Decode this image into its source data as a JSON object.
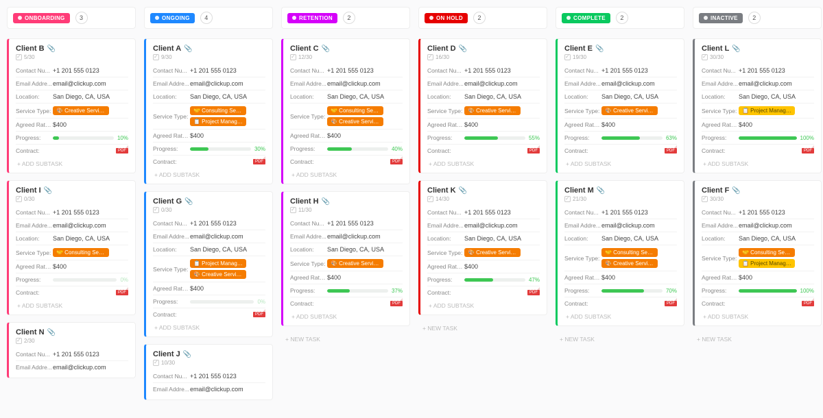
{
  "colors": {
    "onboarding": "#ff3c78",
    "ongoing": "#1e88ff",
    "retention": "#d500f9",
    "onhold": "#e60000",
    "complete": "#0ac95f",
    "inactive": "#7a7d82",
    "tag_orange": "#f57c00",
    "tag_yellow": "#ffc400",
    "prog_green": "#3ec754",
    "prog_lt": "#b8e6c0"
  },
  "labels": {
    "contact": "Contact Nu...",
    "email": "Email Addre...",
    "location": "Location:",
    "service": "Service Type:",
    "rate": "Agreed Rate...",
    "progress": "Progress:",
    "contract": "Contract:",
    "add_subtask": "+ ADD SUBTASK",
    "new_task": "+ NEW TASK"
  },
  "tags": {
    "creative": "🎨 Creative Services",
    "consulting": "🤝 Consulting Servi...",
    "pm": "📋 Project Manage..."
  },
  "defaults": {
    "phone": "+1 201 555 0123",
    "email": "email@clickup.com",
    "loc": "San Diego, CA, USA",
    "rate": "$400"
  },
  "columns": [
    {
      "id": "onboarding",
      "title": "ONBOARDING",
      "count": 3,
      "color": "#ff3c78",
      "cards": [
        {
          "name": "Client B",
          "sub": "5/30",
          "svc": [
            "creative"
          ],
          "progress": 10,
          "pc": "#3ec754"
        },
        {
          "name": "Client I",
          "sub": "0/30",
          "svc": [
            "consulting"
          ],
          "progress": 0,
          "pc": "#b8e6c0"
        },
        {
          "name": "Client N",
          "sub": "2/30",
          "partial": true
        }
      ],
      "newtask": false
    },
    {
      "id": "ongoing",
      "title": "ONGOING",
      "count": 4,
      "color": "#1e88ff",
      "cards": [
        {
          "name": "Client A",
          "sub": "9/30",
          "svc": [
            "consulting",
            "pm"
          ],
          "progress": 30,
          "pc": "#3ec754"
        },
        {
          "name": "Client G",
          "sub": "0/30",
          "svc": [
            "pm",
            "creative"
          ],
          "progress": 0,
          "pc": "#b8e6c0"
        },
        {
          "name": "Client J",
          "sub": "10/30",
          "partial": true
        }
      ],
      "newtask": false
    },
    {
      "id": "retention",
      "title": "RETENTION",
      "count": 2,
      "color": "#d500f9",
      "cards": [
        {
          "name": "Client C",
          "sub": "12/30",
          "svc": [
            "consulting",
            "creative"
          ],
          "progress": 40,
          "pc": "#3ec754"
        },
        {
          "name": "Client H",
          "sub": "11/30",
          "svc": [
            "creative"
          ],
          "progress": 37,
          "pc": "#3ec754"
        }
      ],
      "newtask": true
    },
    {
      "id": "onhold",
      "title": "ON HOLD",
      "count": 2,
      "color": "#e60000",
      "cards": [
        {
          "name": "Client D",
          "sub": "16/30",
          "svc": [
            "creative"
          ],
          "progress": 55,
          "pc": "#3ec754"
        },
        {
          "name": "Client K",
          "sub": "14/30",
          "svc": [
            "creative"
          ],
          "progress": 47,
          "pc": "#3ec754"
        }
      ],
      "newtask": true
    },
    {
      "id": "complete",
      "title": "COMPLETE",
      "count": 2,
      "color": "#0ac95f",
      "cards": [
        {
          "name": "Client E",
          "sub": "19/30",
          "svc": [
            "creative"
          ],
          "progress": 63,
          "pc": "#3ec754"
        },
        {
          "name": "Client M",
          "sub": "21/30",
          "svc": [
            "consulting",
            "creative"
          ],
          "progress": 70,
          "pc": "#3ec754"
        }
      ],
      "newtask": true
    },
    {
      "id": "inactive",
      "title": "INACTIVE",
      "count": 2,
      "color": "#7a7d82",
      "cards": [
        {
          "name": "Client L",
          "sub": "30/30",
          "svc": [
            "pm_y"
          ],
          "progress": 100,
          "pc": "#3ec754"
        },
        {
          "name": "Client F",
          "sub": "30/30",
          "svc": [
            "consulting",
            "pm_y"
          ],
          "progress": 100,
          "pc": "#3ec754"
        }
      ],
      "newtask": true
    }
  ]
}
